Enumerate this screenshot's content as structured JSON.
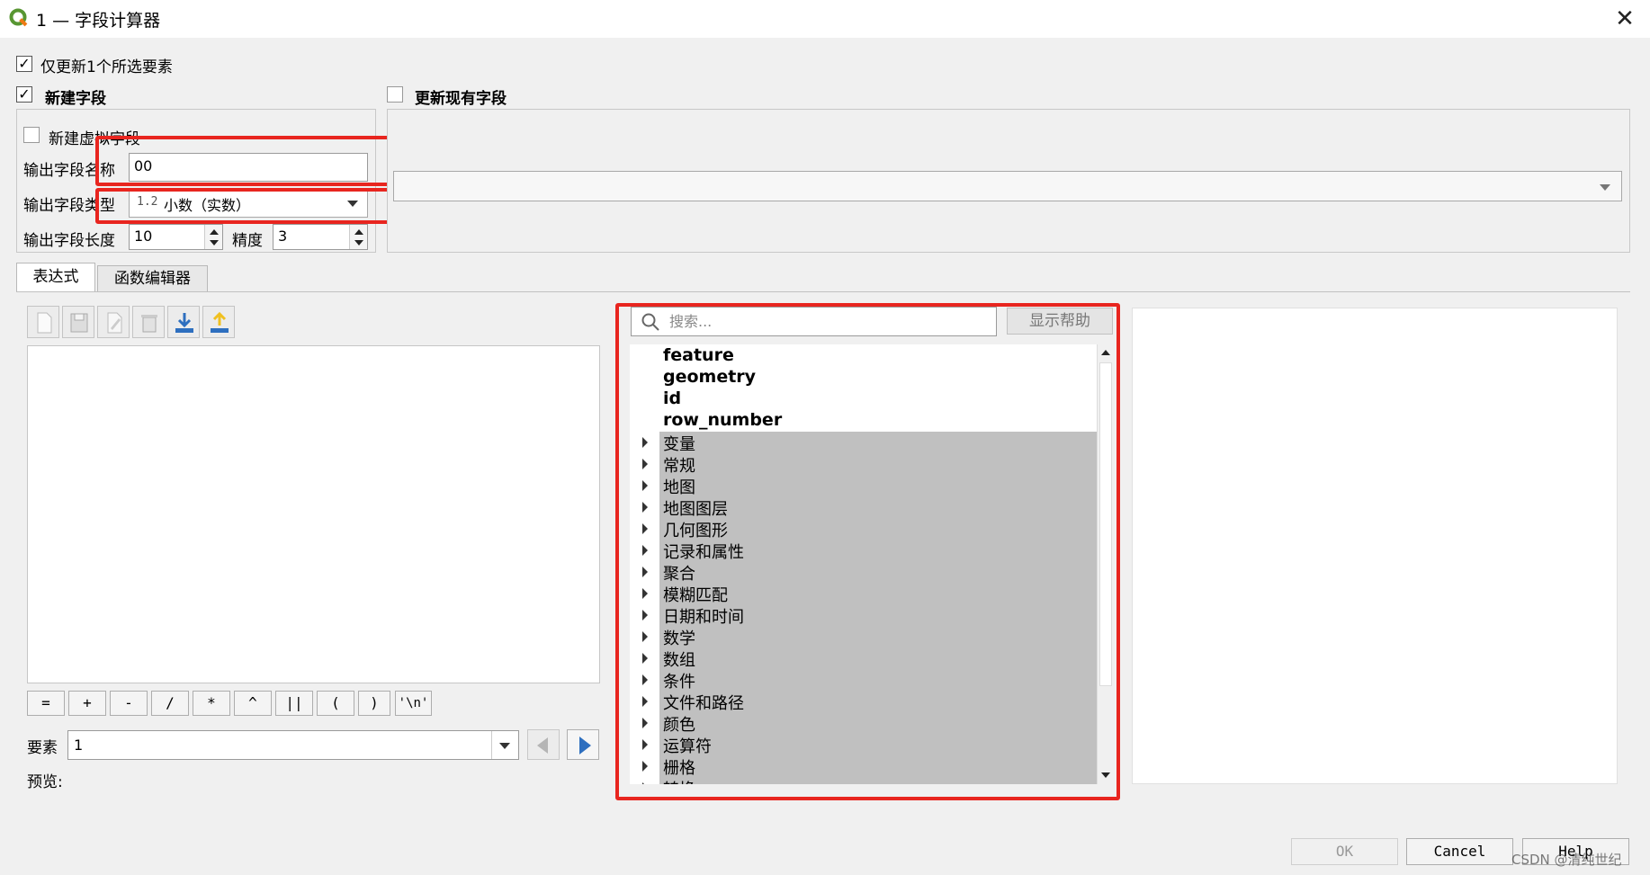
{
  "window": {
    "title": "1 — 字段计算器",
    "close_glyph": "✕",
    "app_icon": "qgis-logo-icon"
  },
  "only_selected": {
    "label": "仅更新1个所选要素",
    "checked": true
  },
  "new_field": {
    "label": "新建字段",
    "checked": true,
    "virtual_label": "新建虚拟字段",
    "name_label": "输出字段名称",
    "name_value": "00",
    "type_label": "输出字段类型",
    "type_prefix": "1.2",
    "type_value": "小数（实数）",
    "length_label": "输出字段长度",
    "length_value": "10",
    "precision_label": "精度",
    "precision_value": "3"
  },
  "update_field": {
    "label": "更新现有字段",
    "checked": false,
    "selected": ""
  },
  "tabs": [
    {
      "label": "表达式",
      "active": true
    },
    {
      "label": "函数编辑器",
      "active": false
    }
  ],
  "operators": [
    "=",
    "+",
    "-",
    "/",
    "*",
    "^",
    "||",
    "(",
    ")",
    "'\\n'"
  ],
  "feature": {
    "label": "要素",
    "value": "1"
  },
  "preview": {
    "label": "预览:"
  },
  "search": {
    "placeholder": "搜索...",
    "show_help": "显示帮助"
  },
  "tree": {
    "top_items": [
      "feature",
      "geometry",
      "id",
      "row_number"
    ],
    "groups": [
      "变量",
      "常规",
      "地图",
      "地图图层",
      "几何图形",
      "记录和属性",
      "聚合",
      "模糊匹配",
      "日期和时间",
      "数学",
      "数组",
      "条件",
      "文件和路径",
      "颜色",
      "运算符",
      "栅格",
      "转换"
    ]
  },
  "buttons": {
    "ok": "OK",
    "cancel": "Cancel",
    "help": "Help"
  },
  "watermark": "CSDN @清纯世纪",
  "colors": {
    "highlight": "#e8251f",
    "tree_group_bg": "#c0c0c0",
    "icon_blue": "#2e6fbf",
    "icon_yellow": "#f0c020"
  }
}
